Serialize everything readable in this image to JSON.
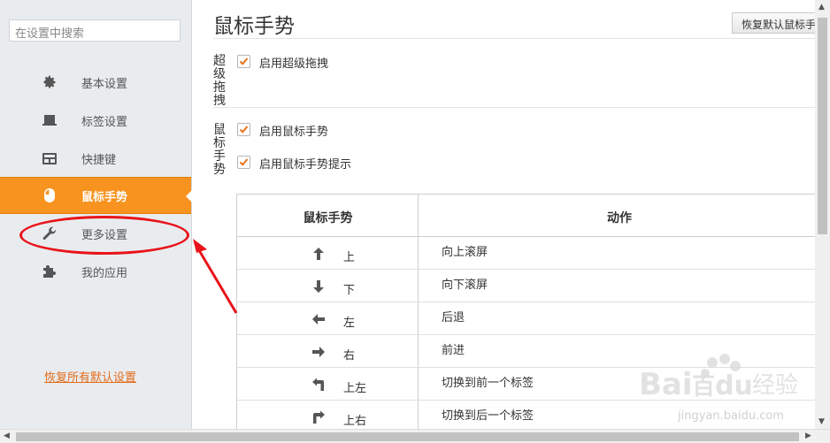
{
  "search": {
    "placeholder": "在设置中搜索"
  },
  "sidebar": {
    "items": [
      {
        "label": "基本设置",
        "icon": "gear-icon"
      },
      {
        "label": "标签设置",
        "icon": "tab-icon"
      },
      {
        "label": "快捷键",
        "icon": "keyboard-icon"
      },
      {
        "label": "鼠标手势",
        "icon": "mouse-icon",
        "active": true
      },
      {
        "label": "更多设置",
        "icon": "wrench-icon"
      },
      {
        "label": "我的应用",
        "icon": "puzzle-icon"
      }
    ],
    "restore_all": "恢复所有默认设置"
  },
  "main": {
    "title": "鼠标手势",
    "restore_button": "恢复默认鼠标手",
    "super_drag": {
      "label": "超级拖拽",
      "option": "启用超级拖拽"
    },
    "gesture": {
      "label": "鼠标手势",
      "options": [
        "启用鼠标手势",
        "启用鼠标手势提示"
      ]
    },
    "table": {
      "headers": [
        "鼠标手势",
        "动作"
      ],
      "rows": [
        {
          "dir": "上",
          "action": "向上滚屏",
          "icon": "arrow-up-icon"
        },
        {
          "dir": "下",
          "action": "向下滚屏",
          "icon": "arrow-down-icon"
        },
        {
          "dir": "左",
          "action": "后退",
          "icon": "arrow-left-icon"
        },
        {
          "dir": "右",
          "action": "前进",
          "icon": "arrow-right-icon"
        },
        {
          "dir": "上左",
          "action": "切换到前一个标签",
          "icon": "arrow-up-left-icon"
        },
        {
          "dir": "上右",
          "action": "切换到后一个标签",
          "icon": "arrow-up-right-icon"
        }
      ]
    }
  },
  "watermark": {
    "brand": "Bai",
    "brand2": "百",
    "brand3": "du",
    "suffix": "经验",
    "url": "jingyan.baidu.com"
  },
  "colors": {
    "accent": "#f7931e",
    "annotation": "#e8141a",
    "link": "#e26b1a"
  }
}
